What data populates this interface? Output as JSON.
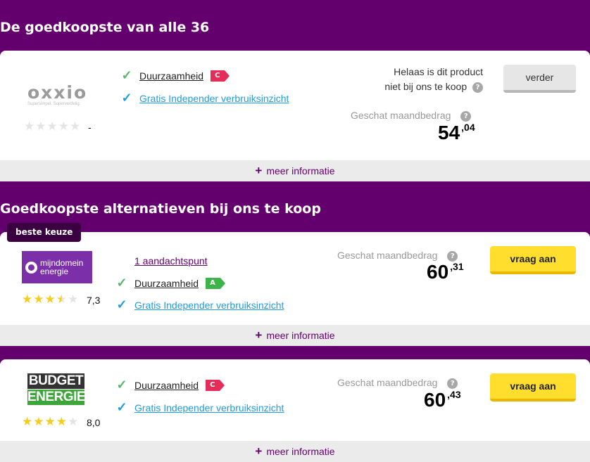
{
  "section1_title": "De goedkoopste van alle 36",
  "section2_title": "Goedkoopste alternatieven bij ons te koop",
  "more_info_label": "meer informatie",
  "estimate_label": "Geschat maandbedrag",
  "question_mark": "?",
  "best_choice_tag": "beste keuze",
  "card1": {
    "logo_name": "oxxio",
    "logo_sub": "Supersimpel. Superverdelig.",
    "rating_value": 0,
    "score": "-",
    "feature_sustainability": "Duurzaamheid",
    "sustainability_label": "C",
    "feature_insight": "Gratis Independer verbruiksinzicht",
    "not_sold_line1": "Helaas is dit product",
    "not_sold_line2": "niet bij ons te koop",
    "price_whole": "54",
    "price_cents": ",04",
    "button": "verder"
  },
  "card2": {
    "logo_line1": "mijndomein",
    "logo_line2": "energie",
    "rating_value": 3.5,
    "score": "7,3",
    "attention": "1 aandachtspunt",
    "feature_sustainability": "Duurzaamheid",
    "sustainability_label": "A",
    "feature_insight": "Gratis Independer verbruiksinzicht",
    "price_whole": "60",
    "price_cents": ",31",
    "button": "vraag aan"
  },
  "card3": {
    "logo_line1": "BUDGET",
    "logo_line2": "ENERGIE",
    "rating_value": 4,
    "score": "8,0",
    "feature_sustainability": "Duurzaamheid",
    "sustainability_label": "C",
    "feature_insight": "Gratis Independer verbruiksinzicht",
    "price_whole": "60",
    "price_cents": ",43",
    "button": "vraag aan"
  },
  "colors": {
    "background": "#64006e",
    "button_yellow": "#ffde2d",
    "check_green": "#5bb56a",
    "link_blue": "#1f9de0",
    "label_c": "#e52d5a",
    "label_a": "#3cb44a"
  }
}
